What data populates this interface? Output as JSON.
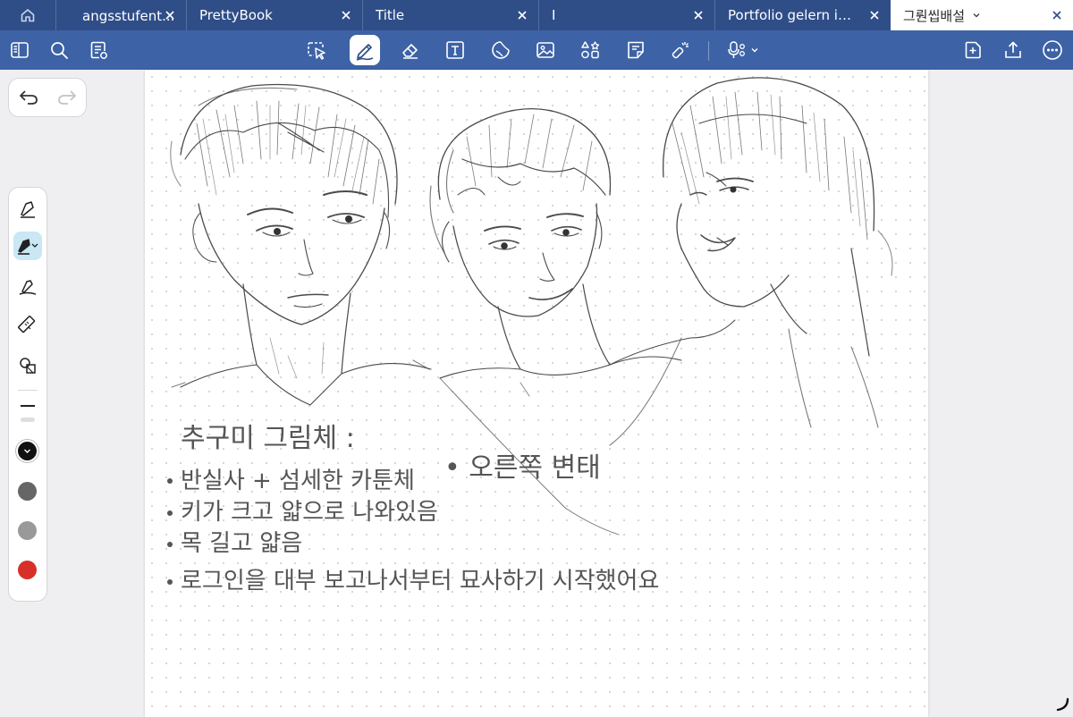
{
  "tabs": [
    {
      "label": "　angsstufent...",
      "active": false
    },
    {
      "label": "PrettyBook",
      "active": false
    },
    {
      "label": "Title",
      "active": false
    },
    {
      "label": "I",
      "active": false
    },
    {
      "label": "Portfolio gelern ist...",
      "active": false
    },
    {
      "label": "그뤈씹배설",
      "active": true
    }
  ],
  "toolbar": {
    "left_icons": [
      "sidebar-icon",
      "search-icon",
      "document-settings-icon"
    ],
    "center_icons": [
      "lasso-icon",
      "pen-icon",
      "eraser-icon",
      "text-box-icon",
      "shape-icon",
      "image-icon",
      "elements-icon",
      "sticky-note-icon",
      "laser-pointer-icon",
      "microphone-icon"
    ],
    "selected": "pen-icon",
    "right_icons": [
      "add-page-icon",
      "share-icon",
      "more-icon"
    ]
  },
  "palette": {
    "tools": [
      "pen-tool",
      "highlighter-pen",
      "brush-pen",
      "ruler",
      "shapes"
    ],
    "selected_tool": "highlighter-pen",
    "colors": [
      "#111111",
      "#666666",
      "#999999",
      "#d7302a"
    ],
    "selected_color": "#111111"
  },
  "colors": {
    "tabbar": "#2f4e88",
    "toolbar": "#3d62a6",
    "canvas_background": "#efeff1"
  },
  "note": {
    "heading": "추구미 그림체 :",
    "bullets": [
      "반실사 + 섬세한 카툰체",
      "키가 크고 얇으로 나와있음",
      "목 길고 얇음",
      "로그인을 대부 보고나서부터\n묘사하기 시작했어요"
    ],
    "side_note": "• 오른쪽 변태"
  }
}
